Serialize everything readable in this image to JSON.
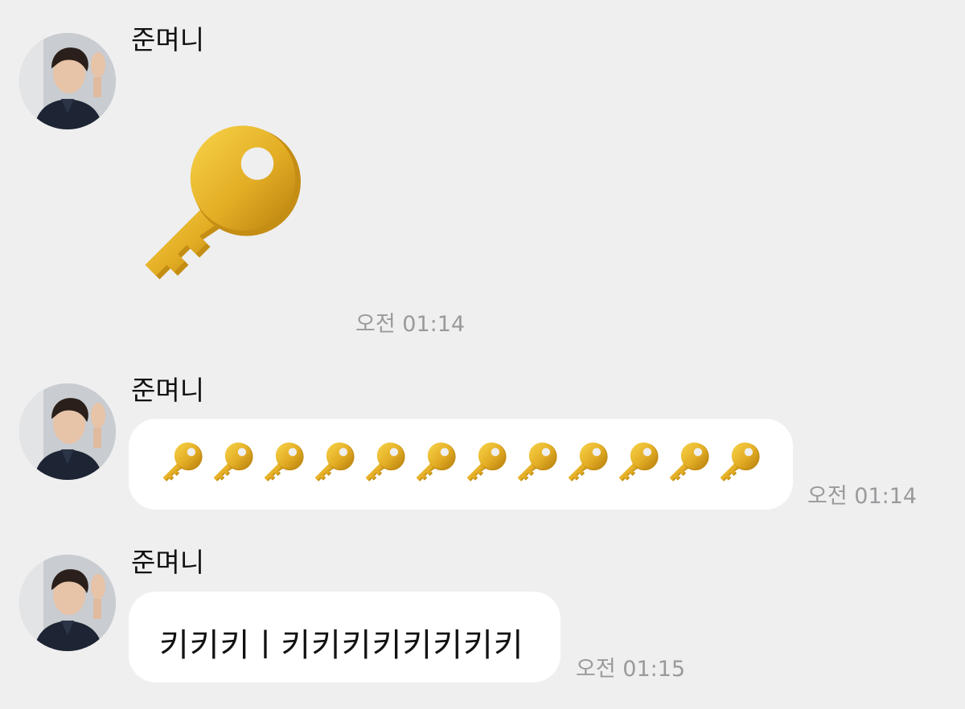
{
  "messages": [
    {
      "sender": "준며니",
      "type": "emoji-large",
      "emoji": "key-icon",
      "time": "오전 01:14"
    },
    {
      "sender": "준며니",
      "type": "emoji-row",
      "emoji": "key-icon",
      "emoji_count": 12,
      "time": "오전 01:14"
    },
    {
      "sender": "준며니",
      "type": "text",
      "text": "키키키ㅣ키키키키키키키키",
      "time": "오전 01:15"
    }
  ],
  "colors": {
    "background": "#efeff0",
    "bubble": "#ffffff",
    "time_text": "#9a9a9c",
    "key_gold": "#e6b22c"
  }
}
